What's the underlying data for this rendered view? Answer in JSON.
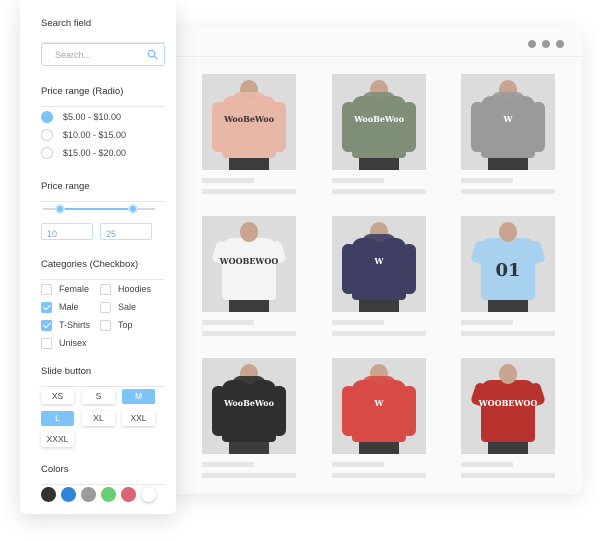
{
  "search": {
    "title": "Search field",
    "placeholder": "Search..."
  },
  "price_radio": {
    "title": "Price range (Radio)",
    "options": [
      {
        "label": "$5.00 - $10.00",
        "selected": true
      },
      {
        "label": "$10.00 - $15.00",
        "selected": false
      },
      {
        "label": "$15.00 - $20.00",
        "selected": false
      }
    ]
  },
  "price_range": {
    "title": "Price range",
    "min": "10",
    "max": "25"
  },
  "categories": {
    "title": "Categories (Checkbox)",
    "items": [
      {
        "label": "Female",
        "checked": false
      },
      {
        "label": "Hoodies",
        "checked": false
      },
      {
        "label": "Male",
        "checked": true
      },
      {
        "label": "Sale",
        "checked": false
      },
      {
        "label": "T-Shirts",
        "checked": true
      },
      {
        "label": "Top",
        "checked": false
      },
      {
        "label": "Unisex",
        "checked": false
      }
    ]
  },
  "sizes": {
    "title": "Slide button",
    "items": [
      {
        "label": "XS",
        "active": false
      },
      {
        "label": "S",
        "active": false
      },
      {
        "label": "M",
        "active": true
      },
      {
        "label": "L",
        "active": true
      },
      {
        "label": "XL",
        "active": false
      },
      {
        "label": "XXL",
        "active": false
      },
      {
        "label": "XXXL",
        "active": false
      }
    ]
  },
  "colors": {
    "title": "Colors",
    "swatches": [
      "#333333",
      "#2f86d8",
      "#9b9b9b",
      "#69cf73",
      "#dc6474",
      "#ffffff"
    ]
  },
  "products": [
    {
      "type": "hoodie",
      "color": "#e8b7a7",
      "print": "WooBeWoo"
    },
    {
      "type": "hoodie",
      "color": "#7f8e76",
      "print": "WooBeWoo"
    },
    {
      "type": "hoodie",
      "color": "#9a9a9a",
      "print": "W"
    },
    {
      "type": "tee",
      "color": "#f4f4f4",
      "print": "WOOBEWOO"
    },
    {
      "type": "hoodie",
      "color": "#3f3f63",
      "print": "W"
    },
    {
      "type": "tee",
      "color": "#a8d0ef",
      "print": "01"
    },
    {
      "type": "hoodie",
      "color": "#2f2f2f",
      "print": "WooBeWoo"
    },
    {
      "type": "hoodie",
      "color": "#d84b46",
      "print": "W"
    },
    {
      "type": "tee",
      "color": "#b8322e",
      "print": "WOOBEWOO"
    }
  ]
}
